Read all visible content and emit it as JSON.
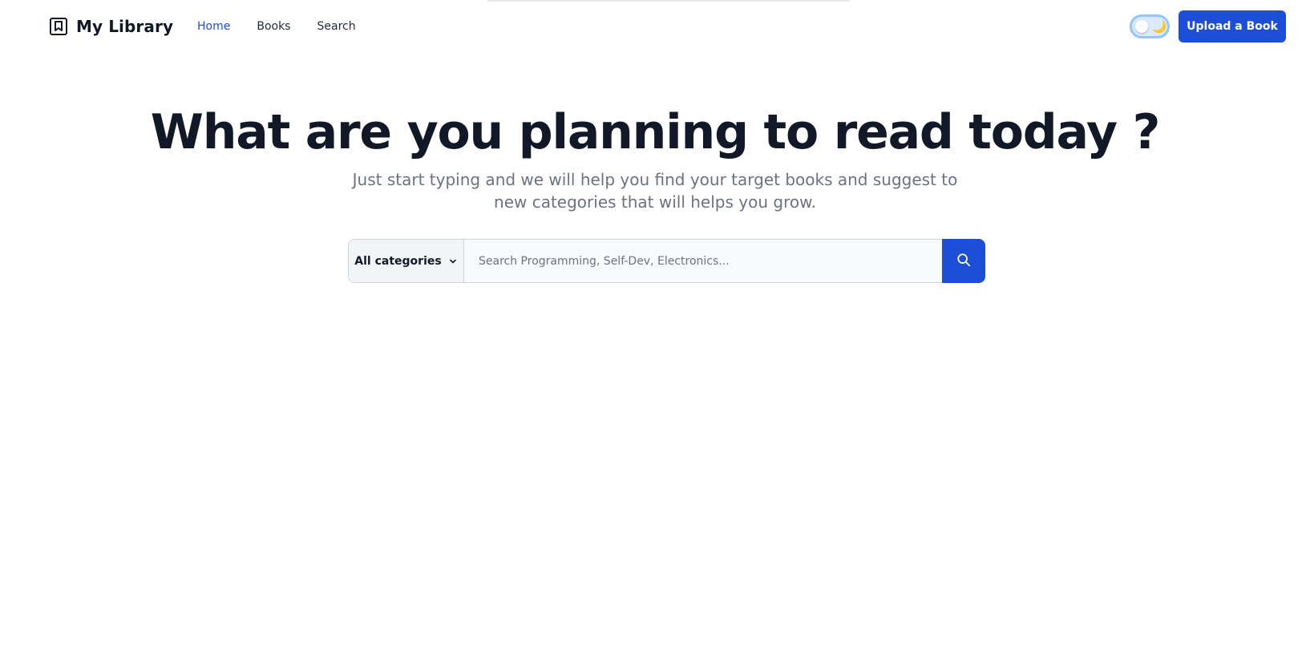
{
  "brand": {
    "name": "My Library",
    "icon": "book-icon"
  },
  "nav": {
    "items": [
      {
        "label": "Home",
        "active": true
      },
      {
        "label": "Books",
        "active": false
      },
      {
        "label": "Search",
        "active": false
      }
    ]
  },
  "theme_toggle": {
    "icon": "moon-icon",
    "glyph": "🌙",
    "state": "light"
  },
  "actions": {
    "upload_label": "Upload a Book"
  },
  "hero": {
    "title": "What are you planning to read today ?",
    "subtitle": "Just start typing and we will help you find your target books and suggest to new categories that will helps you grow."
  },
  "search": {
    "category_label": "All categories",
    "placeholder": "Search Programming, Self-Dev, Electronics...",
    "value": "",
    "submit_icon": "search-icon"
  },
  "colors": {
    "accent": "#1d4ed8",
    "text": "#111827",
    "muted": "#6b7280",
    "toggle_track": "#dbeafe"
  }
}
